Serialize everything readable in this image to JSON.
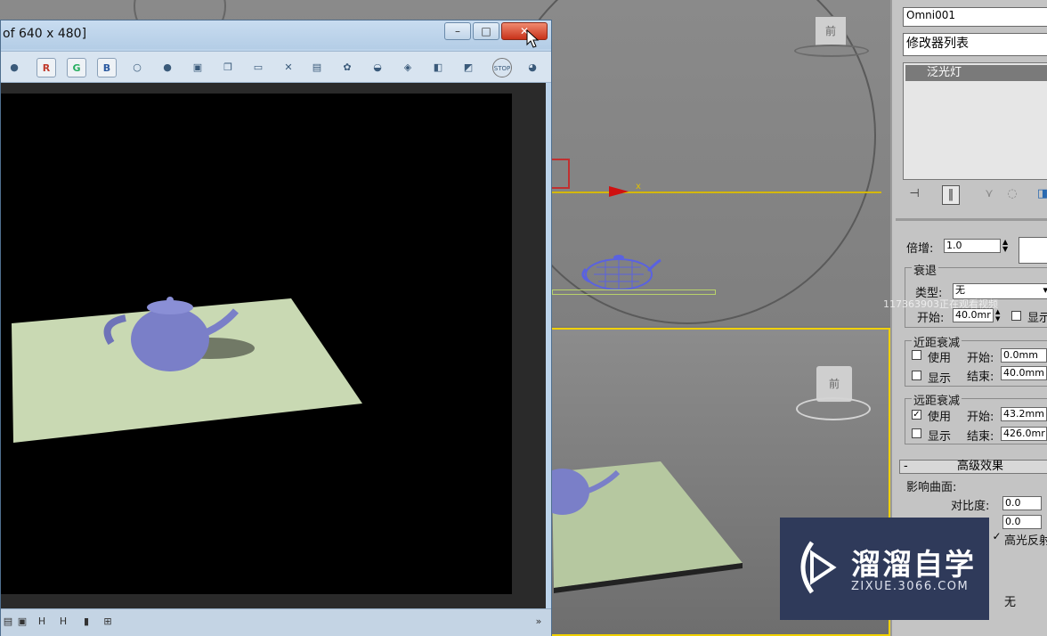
{
  "render_window": {
    "title": "of 640 x 480]",
    "buttons": {
      "minimize": "–",
      "maximize": "□",
      "close": "✕"
    },
    "toolbar": [
      {
        "name": "color-wheel-icon",
        "glyph": "●"
      },
      {
        "name": "red-channel-icon",
        "glyph": "R",
        "color": "#c0392b"
      },
      {
        "name": "green-channel-icon",
        "glyph": "G",
        "color": "#27ae60"
      },
      {
        "name": "blue-channel-icon",
        "glyph": "B",
        "color": "#2c5aa0"
      },
      {
        "name": "white-circle-icon",
        "glyph": "○"
      },
      {
        "name": "gray-circle-icon",
        "glyph": "●"
      },
      {
        "name": "save-icon",
        "glyph": "▣"
      },
      {
        "name": "clone-icon",
        "glyph": "❐"
      },
      {
        "name": "open-folder-icon",
        "glyph": "▭"
      },
      {
        "name": "clear-icon",
        "glyph": "✕"
      },
      {
        "name": "print-icon",
        "glyph": "▤"
      },
      {
        "name": "render-setup-icon",
        "glyph": "✿"
      },
      {
        "name": "teapot-render-icon",
        "glyph": "◒"
      },
      {
        "name": "frame-window-icon",
        "glyph": "◈"
      },
      {
        "name": "region-icon",
        "glyph": "◧"
      },
      {
        "name": "crop-icon",
        "glyph": "◩"
      },
      {
        "name": "stop-icon",
        "glyph": "STOP"
      },
      {
        "name": "render-icon",
        "glyph": "◕"
      }
    ],
    "statusbar": [
      {
        "name": "frame-icon",
        "glyph": "▤"
      },
      {
        "name": "zoom-icon",
        "glyph": "▣"
      },
      {
        "name": "h-icon",
        "glyph": "H"
      },
      {
        "name": "h-split-icon",
        "glyph": "H"
      },
      {
        "name": "bar-chart-icon",
        "glyph": "▮"
      },
      {
        "name": "grid-icon",
        "glyph": "⊞"
      },
      {
        "name": "expand-icon",
        "glyph": "»"
      }
    ]
  },
  "viewport": {
    "viewcube_top_label": "前",
    "viewcube_bottom_label": "前",
    "axis_x_label": "x"
  },
  "panel": {
    "object_name": "Omni001",
    "modifier_list": "修改器列表",
    "stack_item": "泛光灯",
    "multiplier_label": "倍增:",
    "multiplier_value": "1.0",
    "decay_group": "衰退",
    "type_label": "类型:",
    "type_value": "无",
    "start_label": "开始:",
    "start_value": "40.0mr",
    "show_label": "显示",
    "near_group": "近距衰减",
    "near_use": "使用",
    "near_start_label": "开始:",
    "near_start_value": "0.0mm",
    "near_show": "显示",
    "near_end_label": "结束:",
    "near_end_value": "40.0mm",
    "far_group": "远距衰减",
    "far_use": "使用",
    "far_start_label": "开始:",
    "far_start_value": "43.2mm",
    "far_show": "显示",
    "far_end_label": "结束:",
    "far_end_value": "426.0mr",
    "advanced_rollout": "高级效果",
    "advanced_toggle": "-",
    "affect_surfaces": "影响曲面:",
    "contrast_label": "对比度:",
    "contrast_value": "0.0",
    "soften_value": "0.0",
    "specular_label": "高光反射",
    "projector_value": "无"
  },
  "overlay": {
    "watermark": "117363903正在观看视频",
    "logo_main": "溜溜自学",
    "logo_sub": "ZIXUE.3066.COM"
  },
  "colors": {
    "teapot": "#7a7fc8",
    "plane": "#c8d8b0",
    "viewport_teapot": "#5a62e0",
    "logo_bg": "#2f3a5a"
  }
}
